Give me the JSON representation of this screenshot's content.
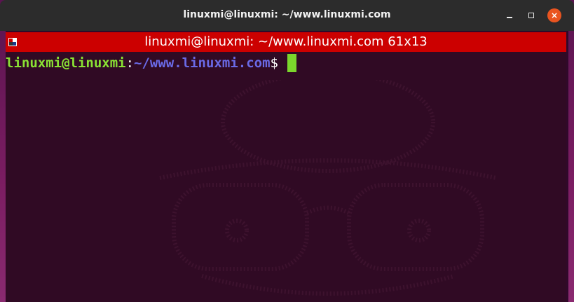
{
  "window": {
    "title": "linuxmi@linuxmi: ~/www.linuxmi.com",
    "minimize_icon": "minimize-icon",
    "maximize_icon": "maximize-icon",
    "close_icon": "close-icon",
    "close_glyph": "×"
  },
  "tab": {
    "title": "linuxmi@linuxmi: ~/www.linuxmi.com 61x13",
    "icon": "terminal-menu-icon",
    "color": "#cc0000"
  },
  "terminal": {
    "background": "#300a24",
    "prompt": {
      "user_host": "linuxmi@linuxmi",
      "colon": ":",
      "path": "~/www.linuxmi.com",
      "symbol": "$"
    },
    "cursor_color": "#7bd62c"
  }
}
